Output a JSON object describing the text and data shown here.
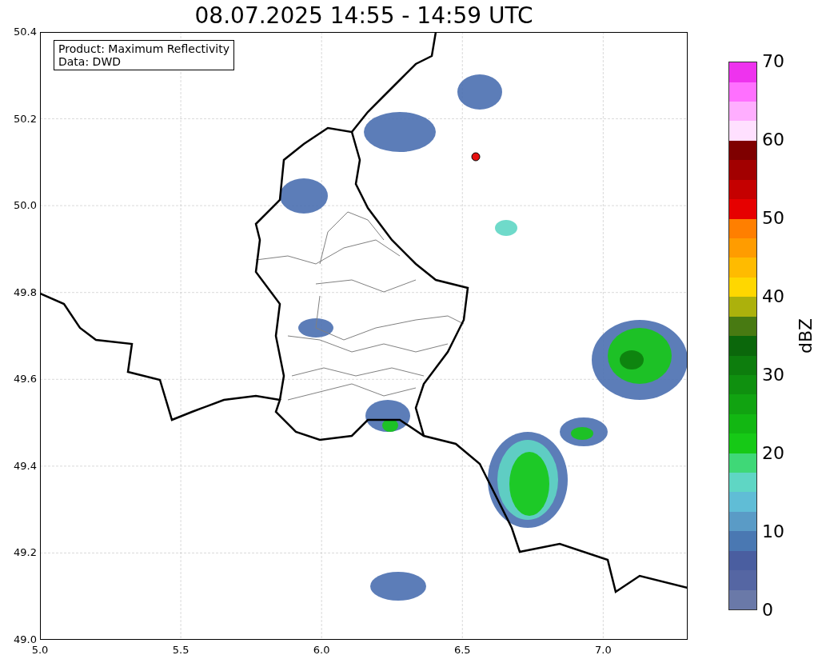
{
  "title": "08.07.2025 14:55 - 14:59 UTC",
  "legend": [
    "Product: Maximum Reflectivity",
    "Data: DWD"
  ],
  "map": {
    "x_ticks": [
      "5.0",
      "5.5",
      "6.0",
      "6.5",
      "7.0"
    ],
    "y_ticks": [
      "50.4",
      "50.2",
      "50.0",
      "49.8",
      "49.6",
      "49.4",
      "49.2",
      "49.0"
    ]
  },
  "colorbar": {
    "label": "dBZ",
    "ticks": [
      "70",
      "60",
      "50",
      "40",
      "30",
      "20",
      "10",
      "0"
    ],
    "segments": [
      {
        "color": "#6a79a8"
      },
      {
        "color": "#5566a3"
      },
      {
        "color": "#4a5ea0"
      },
      {
        "color": "#4a78b2"
      },
      {
        "color": "#5a9bc6"
      },
      {
        "color": "#60bdd6"
      },
      {
        "color": "#5fd6c4"
      },
      {
        "color": "#3fd877"
      },
      {
        "color": "#16c916"
      },
      {
        "color": "#12b712"
      },
      {
        "color": "#11a311"
      },
      {
        "color": "#0f900f"
      },
      {
        "color": "#0d7d0d"
      },
      {
        "color": "#0b670b"
      },
      {
        "color": "#487a12"
      },
      {
        "color": "#acb10c"
      },
      {
        "color": "#ffd700"
      },
      {
        "color": "#ffbb00"
      },
      {
        "color": "#ff9c00"
      },
      {
        "color": "#ff7f00"
      },
      {
        "color": "#e60000"
      },
      {
        "color": "#c50000"
      },
      {
        "color": "#a20000"
      },
      {
        "color": "#7f0000"
      },
      {
        "color": "#ffe0ff"
      },
      {
        "color": "#ffaeff"
      },
      {
        "color": "#ff70ff"
      },
      {
        "color": "#ee33ee"
      }
    ]
  }
}
